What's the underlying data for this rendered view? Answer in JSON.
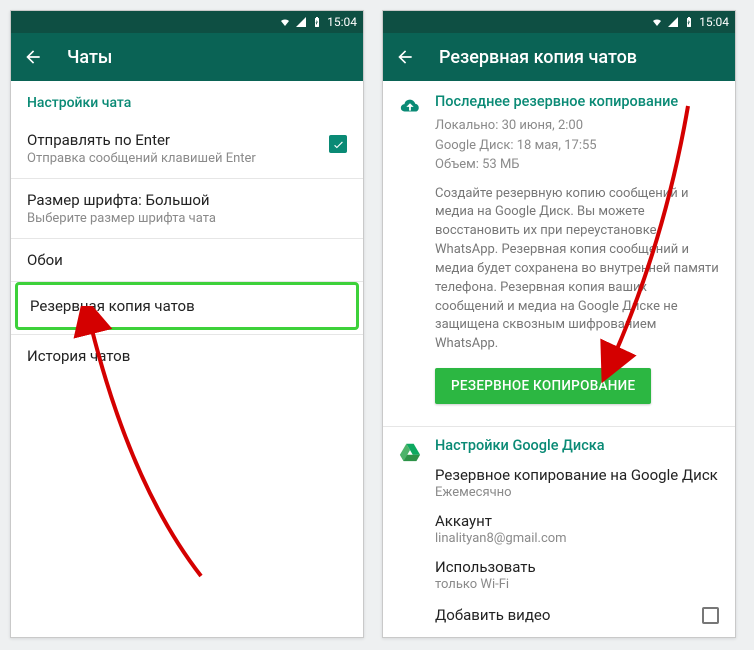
{
  "statusbar": {
    "time": "15:04"
  },
  "screen1": {
    "title": "Чаты",
    "section": "Настройки чата",
    "enter": {
      "title": "Отправлять по Enter",
      "sub": "Отправка сообщений клавишей Enter"
    },
    "font": {
      "title": "Размер шрифта: Большой",
      "sub": "Выберите размер шрифта чата"
    },
    "wallpaper": "Обои",
    "backup": "Резервная копия чатов",
    "history": "История чатов"
  },
  "screen2": {
    "title": "Резервная копия чатов",
    "last_backup_title": "Последнее резервное копирование",
    "local": "Локально: 30 июня, 2:00",
    "gdrive_line": "Google Диск: 18 мая, 17:55",
    "size": "Объем: 53 МБ",
    "desc": "Создайте резервную копию сообщений и медиа на Google Диск. Вы можете восстановить их при переустановке WhatsApp. Резервная копия сообщений и медиа будет сохранена во внутренней памяти телефона. Резервная копия ваших сообщений и медиа на Google Диске не защищена сквозным шифрованием WhatsApp.",
    "button": "РЕЗЕРВНОЕ КОПИРОВАНИЕ",
    "gdrive_title": "Настройки Google Диска",
    "freq": {
      "label": "Резервное копирование на Google Диск",
      "value": "Ежемесячно"
    },
    "account": {
      "label": "Аккаунт",
      "value": "linalityan8@gmail.com"
    },
    "network": {
      "label": "Использовать",
      "value": "только Wi-Fi"
    },
    "video": "Добавить видео"
  }
}
